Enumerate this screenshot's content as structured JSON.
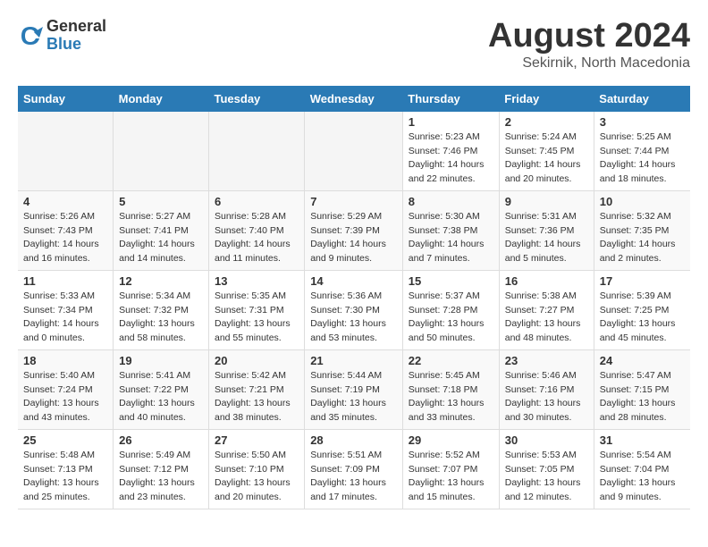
{
  "logo": {
    "general": "General",
    "blue": "Blue"
  },
  "title": "August 2024",
  "location": "Sekirnik, North Macedonia",
  "days_of_week": [
    "Sunday",
    "Monday",
    "Tuesday",
    "Wednesday",
    "Thursday",
    "Friday",
    "Saturday"
  ],
  "weeks": [
    [
      {
        "day": "",
        "info": ""
      },
      {
        "day": "",
        "info": ""
      },
      {
        "day": "",
        "info": ""
      },
      {
        "day": "",
        "info": ""
      },
      {
        "day": "1",
        "info": "Sunrise: 5:23 AM\nSunset: 7:46 PM\nDaylight: 14 hours\nand 22 minutes."
      },
      {
        "day": "2",
        "info": "Sunrise: 5:24 AM\nSunset: 7:45 PM\nDaylight: 14 hours\nand 20 minutes."
      },
      {
        "day": "3",
        "info": "Sunrise: 5:25 AM\nSunset: 7:44 PM\nDaylight: 14 hours\nand 18 minutes."
      }
    ],
    [
      {
        "day": "4",
        "info": "Sunrise: 5:26 AM\nSunset: 7:43 PM\nDaylight: 14 hours\nand 16 minutes."
      },
      {
        "day": "5",
        "info": "Sunrise: 5:27 AM\nSunset: 7:41 PM\nDaylight: 14 hours\nand 14 minutes."
      },
      {
        "day": "6",
        "info": "Sunrise: 5:28 AM\nSunset: 7:40 PM\nDaylight: 14 hours\nand 11 minutes."
      },
      {
        "day": "7",
        "info": "Sunrise: 5:29 AM\nSunset: 7:39 PM\nDaylight: 14 hours\nand 9 minutes."
      },
      {
        "day": "8",
        "info": "Sunrise: 5:30 AM\nSunset: 7:38 PM\nDaylight: 14 hours\nand 7 minutes."
      },
      {
        "day": "9",
        "info": "Sunrise: 5:31 AM\nSunset: 7:36 PM\nDaylight: 14 hours\nand 5 minutes."
      },
      {
        "day": "10",
        "info": "Sunrise: 5:32 AM\nSunset: 7:35 PM\nDaylight: 14 hours\nand 2 minutes."
      }
    ],
    [
      {
        "day": "11",
        "info": "Sunrise: 5:33 AM\nSunset: 7:34 PM\nDaylight: 14 hours\nand 0 minutes."
      },
      {
        "day": "12",
        "info": "Sunrise: 5:34 AM\nSunset: 7:32 PM\nDaylight: 13 hours\nand 58 minutes."
      },
      {
        "day": "13",
        "info": "Sunrise: 5:35 AM\nSunset: 7:31 PM\nDaylight: 13 hours\nand 55 minutes."
      },
      {
        "day": "14",
        "info": "Sunrise: 5:36 AM\nSunset: 7:30 PM\nDaylight: 13 hours\nand 53 minutes."
      },
      {
        "day": "15",
        "info": "Sunrise: 5:37 AM\nSunset: 7:28 PM\nDaylight: 13 hours\nand 50 minutes."
      },
      {
        "day": "16",
        "info": "Sunrise: 5:38 AM\nSunset: 7:27 PM\nDaylight: 13 hours\nand 48 minutes."
      },
      {
        "day": "17",
        "info": "Sunrise: 5:39 AM\nSunset: 7:25 PM\nDaylight: 13 hours\nand 45 minutes."
      }
    ],
    [
      {
        "day": "18",
        "info": "Sunrise: 5:40 AM\nSunset: 7:24 PM\nDaylight: 13 hours\nand 43 minutes."
      },
      {
        "day": "19",
        "info": "Sunrise: 5:41 AM\nSunset: 7:22 PM\nDaylight: 13 hours\nand 40 minutes."
      },
      {
        "day": "20",
        "info": "Sunrise: 5:42 AM\nSunset: 7:21 PM\nDaylight: 13 hours\nand 38 minutes."
      },
      {
        "day": "21",
        "info": "Sunrise: 5:44 AM\nSunset: 7:19 PM\nDaylight: 13 hours\nand 35 minutes."
      },
      {
        "day": "22",
        "info": "Sunrise: 5:45 AM\nSunset: 7:18 PM\nDaylight: 13 hours\nand 33 minutes."
      },
      {
        "day": "23",
        "info": "Sunrise: 5:46 AM\nSunset: 7:16 PM\nDaylight: 13 hours\nand 30 minutes."
      },
      {
        "day": "24",
        "info": "Sunrise: 5:47 AM\nSunset: 7:15 PM\nDaylight: 13 hours\nand 28 minutes."
      }
    ],
    [
      {
        "day": "25",
        "info": "Sunrise: 5:48 AM\nSunset: 7:13 PM\nDaylight: 13 hours\nand 25 minutes."
      },
      {
        "day": "26",
        "info": "Sunrise: 5:49 AM\nSunset: 7:12 PM\nDaylight: 13 hours\nand 23 minutes."
      },
      {
        "day": "27",
        "info": "Sunrise: 5:50 AM\nSunset: 7:10 PM\nDaylight: 13 hours\nand 20 minutes."
      },
      {
        "day": "28",
        "info": "Sunrise: 5:51 AM\nSunset: 7:09 PM\nDaylight: 13 hours\nand 17 minutes."
      },
      {
        "day": "29",
        "info": "Sunrise: 5:52 AM\nSunset: 7:07 PM\nDaylight: 13 hours\nand 15 minutes."
      },
      {
        "day": "30",
        "info": "Sunrise: 5:53 AM\nSunset: 7:05 PM\nDaylight: 13 hours\nand 12 minutes."
      },
      {
        "day": "31",
        "info": "Sunrise: 5:54 AM\nSunset: 7:04 PM\nDaylight: 13 hours\nand 9 minutes."
      }
    ]
  ]
}
